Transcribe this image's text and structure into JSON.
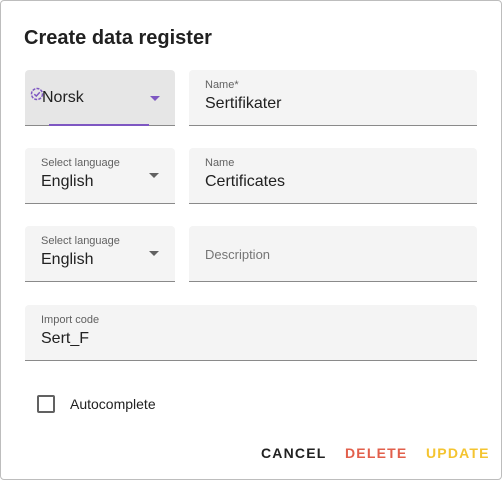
{
  "dialog": {
    "title": "Create data register"
  },
  "language_selector_active": {
    "value": "Norsk"
  },
  "name_norsk": {
    "label": "Name",
    "required_mark": "*",
    "value": "Sertifikater"
  },
  "language_selector_2": {
    "label": "Select language",
    "value": "English"
  },
  "name_english": {
    "label": "Name",
    "value": "Certificates"
  },
  "language_selector_3": {
    "label": "Select language",
    "value": "English"
  },
  "description": {
    "placeholder": "Description"
  },
  "import_code": {
    "label": "Import code",
    "value": "Sert_F"
  },
  "autocomplete": {
    "label": "Autocomplete",
    "checked": false
  },
  "actions": {
    "cancel": "CANCEL",
    "delete": "DELETE",
    "update": "UPDATE"
  },
  "colors": {
    "accent": "#7e57c2",
    "cancel": "#212121",
    "delete": "#e25f4b",
    "update": "#f4c430"
  },
  "icons": {
    "language_status": "check-badge-icon",
    "dropdown": "caret-down-icon"
  }
}
